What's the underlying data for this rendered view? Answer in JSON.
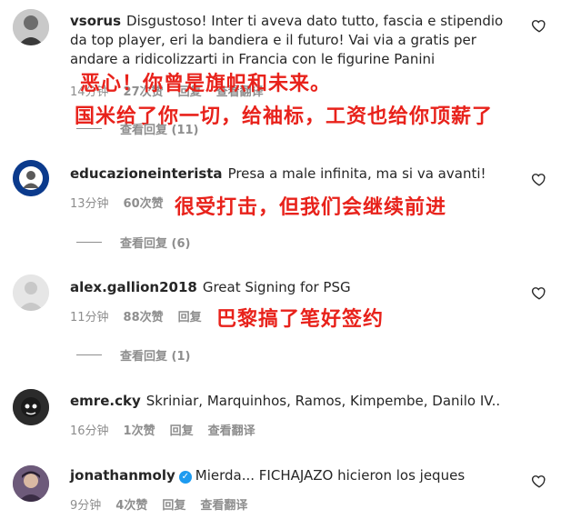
{
  "comments": [
    {
      "username": "vsorus",
      "text": "Disgustoso! Inter ti aveva dato tutto, fascia e stipendio da top player, eri la bandiera e il futuro! Vai via a gratis per andare a ridicolizzarti in Francia con le figurine Panini",
      "time": "14分钟",
      "likes": "27次赞",
      "reply": "回复",
      "translate": "查看翻译",
      "view_replies": "查看回复 (11)",
      "overlay_lines": [
        "恶心！你曾是旗帜和未来。",
        "国米给了你一切，给袖标，工资也给你顶薪了"
      ]
    },
    {
      "username": "educazioneinterista",
      "text": "Presa a male infinita, ma si va avanti!",
      "time": "13分钟",
      "likes": "60次赞",
      "view_replies": "查看回复 (6)",
      "overlay_lines": [
        "很受打击，但我们会继续前进"
      ]
    },
    {
      "username": "alex.gallion2018",
      "text": "Great Signing for PSG",
      "time": "11分钟",
      "likes": "88次赞",
      "reply": "回复",
      "view_replies": "查看回复 (1)",
      "overlay_lines": [
        "巴黎搞了笔好签约"
      ]
    },
    {
      "username": "emre.cky",
      "text": "Skriniar, Marquinhos, Ramos, Kimpembe, Danilo IV..",
      "time": "16分钟",
      "likes": "1次赞",
      "reply": "回复",
      "translate": "查看翻译"
    },
    {
      "username": "jonathanmoly",
      "verified": true,
      "text": "Mierda... FICHAJAZO hicieron los jeques",
      "time": "9分钟",
      "likes": "4次赞",
      "reply": "回复",
      "translate": "查看翻译"
    }
  ],
  "colors": {
    "overlay_red": "#e8221b",
    "meta_gray": "#8e8e8e",
    "verified_blue": "#1d9bf0"
  },
  "icons": {
    "like": "heart-icon",
    "verified": "verified-badge-icon"
  }
}
